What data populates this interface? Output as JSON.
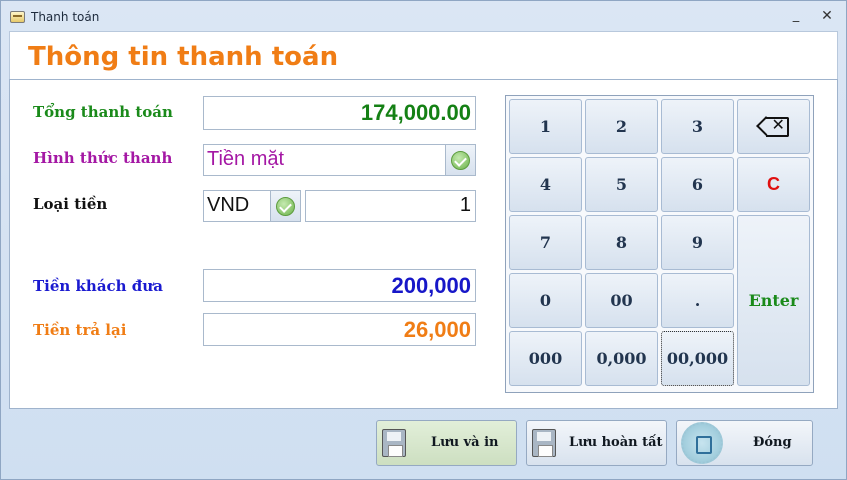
{
  "window": {
    "title": "Thanh toán",
    "minimize": "_",
    "close": "✕"
  },
  "header": {
    "title": "Thông tin thanh toán"
  },
  "form": {
    "total_label": "Tổng thanh toán",
    "total_value": "174,000.00",
    "method_label": "Hình thức thanh",
    "method_value": "Tiền mặt",
    "currency_label": "Loại tiền",
    "currency_value": "VND",
    "rate_value": "1",
    "given_label": "Tiền khách đưa",
    "given_value": "200,000",
    "change_label": "Tiền trả lại",
    "change_value": "26,000"
  },
  "keypad": {
    "k1": "1",
    "k2": "2",
    "k3": "3",
    "backspace_icon": "backspace-icon",
    "k4": "4",
    "k5": "5",
    "k6": "6",
    "clear": "C",
    "k7": "7",
    "k8": "8",
    "k9": "9",
    "enter": "Enter",
    "k0": "0",
    "k00": "00",
    "dot": ".",
    "k000": "000",
    "k0000": "0,000",
    "k00000": "00,000"
  },
  "buttons": {
    "save_print": "Lưu và in",
    "save_done": "Lưu hoàn tất",
    "close": "Đóng"
  },
  "colors": {
    "title_orange": "#f07d15",
    "total_green": "#148014",
    "method_purple": "#a417a4",
    "given_blue": "#1717c8",
    "clear_red": "#e01010"
  }
}
